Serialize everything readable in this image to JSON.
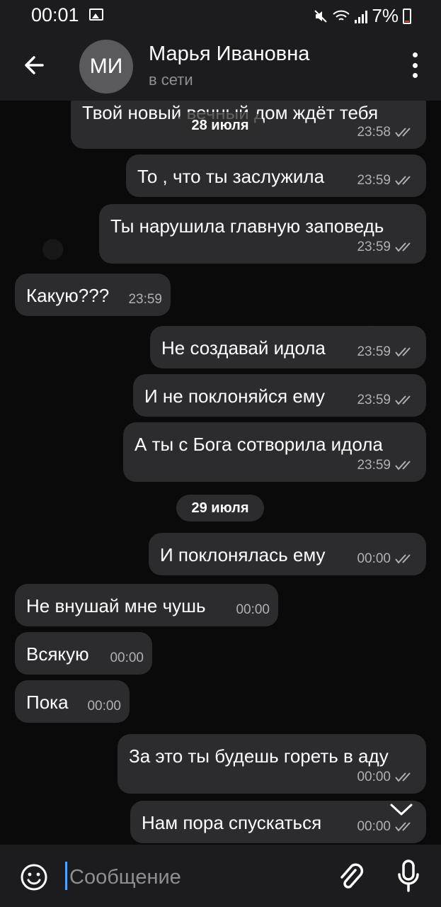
{
  "status_bar": {
    "time": "00:01",
    "battery_percent": "7%",
    "icons": [
      "gallery-icon",
      "mute-icon",
      "wifi-icon",
      "signal-icon",
      "battery-icon"
    ]
  },
  "header": {
    "avatar_initials": "МИ",
    "name": "Марья Ивановна",
    "status": "в сети",
    "icons": [
      "back-arrow-icon",
      "more-vert-icon"
    ]
  },
  "chat": {
    "date_pills": [
      "28 июля",
      "29 июля"
    ],
    "messages": [
      {
        "dir": "out",
        "text": "Твой новый вечный дом ждёт тебя",
        "time": "23:58",
        "read": true
      },
      {
        "dir": "out",
        "text": "То , что ты заслужила",
        "time": "23:59",
        "read": true
      },
      {
        "dir": "out",
        "text": "Ты нарушила главную заповедь",
        "time": "23:59",
        "read": true
      },
      {
        "dir": "in",
        "text": "Какую???",
        "time": "23:59"
      },
      {
        "dir": "out",
        "text": "Не создавай идола",
        "time": "23:59",
        "read": true
      },
      {
        "dir": "out",
        "text": "И не поклоняйся ему",
        "time": "23:59",
        "read": true
      },
      {
        "dir": "out",
        "text": "А ты с Бога  сотворила идола",
        "time": "23:59",
        "read": true
      },
      {
        "dir": "out",
        "text": "И поклонялась ему",
        "time": "00:00",
        "read": true
      },
      {
        "dir": "in",
        "text": "Не внушай мне чушь",
        "time": "00:00"
      },
      {
        "dir": "in",
        "text": "Всякую",
        "time": "00:00"
      },
      {
        "dir": "in",
        "text": "Пока",
        "time": "00:00"
      },
      {
        "dir": "out",
        "text": "За это ты будешь гореть в аду",
        "time": "00:00",
        "read": true
      },
      {
        "dir": "out",
        "text": "Нам пора спускаться",
        "time": "00:00",
        "read": true
      }
    ]
  },
  "composer": {
    "placeholder": "Сообщение",
    "icons": [
      "emoji-icon",
      "attach-icon",
      "mic-icon"
    ]
  },
  "colors": {
    "bubble": "#2c2c2e",
    "bar": "#1c1c1e",
    "time_text": "#b0b0b5",
    "caret": "#4da3ff"
  }
}
